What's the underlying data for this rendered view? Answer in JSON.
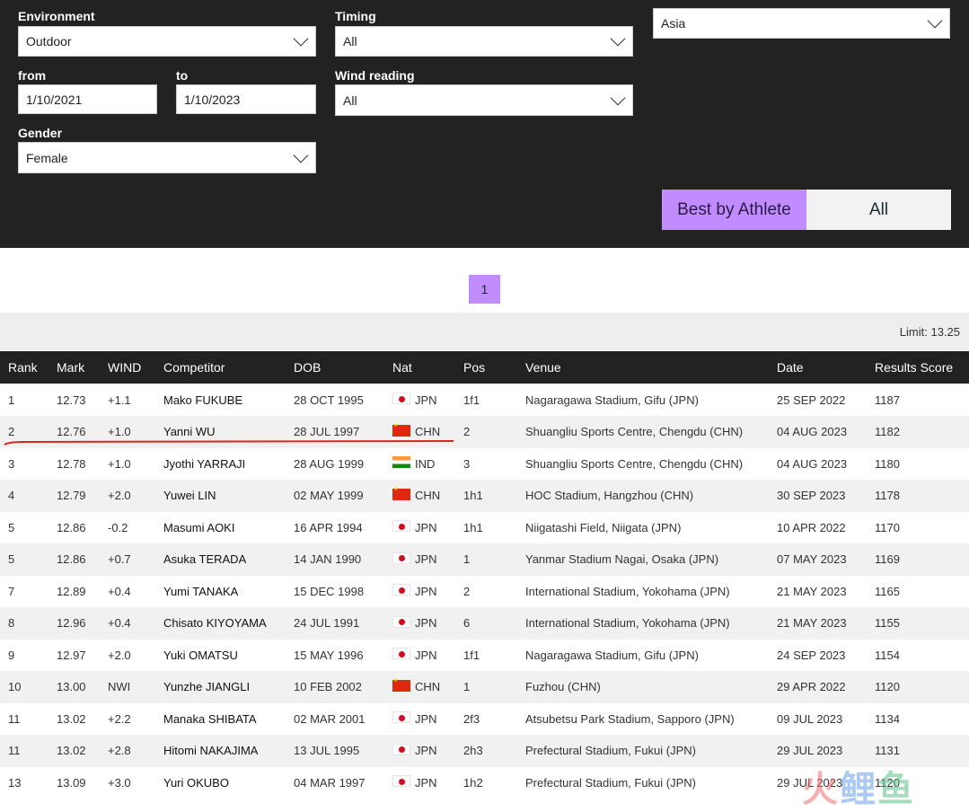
{
  "filters": {
    "environment": {
      "label": "Environment",
      "value": "Outdoor"
    },
    "from": {
      "label": "from",
      "value": "1/10/2021"
    },
    "to": {
      "label": "to",
      "value": "1/10/2023"
    },
    "gender": {
      "label": "Gender",
      "value": "Female"
    },
    "timing": {
      "label": "Timing",
      "value": "All"
    },
    "wind": {
      "label": "Wind reading",
      "value": "All"
    },
    "region": {
      "value": "Asia"
    }
  },
  "toggle": {
    "best": "Best by Athlete",
    "all": "All",
    "active": "best",
    "accent": "#c08cff"
  },
  "pagination": {
    "current": "1"
  },
  "limit": "Limit: 13.25",
  "table": {
    "headers": [
      "Rank",
      "Mark",
      "WIND",
      "Competitor",
      "DOB",
      "Nat",
      "Pos",
      "Venue",
      "Date",
      "Results Score"
    ],
    "rows": [
      {
        "rank": "1",
        "mark": "12.73",
        "wind": "+1.1",
        "name": "Mako FUKUBE",
        "dob": "28 OCT 1995",
        "flag": "jpn",
        "nat": "JPN",
        "pos": "1f1",
        "venue": "Nagaragawa Stadium, Gifu (JPN)",
        "date": "25 SEP 2022",
        "score": "1187"
      },
      {
        "rank": "2",
        "mark": "12.76",
        "wind": "+1.0",
        "name": "Yanni WU",
        "dob": "28 JUL 1997",
        "flag": "chn",
        "nat": "CHN",
        "pos": "2",
        "venue": "Shuangliu Sports Centre, Chengdu (CHN)",
        "date": "04 AUG 2023",
        "score": "1182"
      },
      {
        "rank": "3",
        "mark": "12.78",
        "wind": "+1.0",
        "name": "Jyothi YARRAJI",
        "dob": "28 AUG 1999",
        "flag": "ind",
        "nat": "IND",
        "pos": "3",
        "venue": "Shuangliu Sports Centre, Chengdu (CHN)",
        "date": "04 AUG 2023",
        "score": "1180"
      },
      {
        "rank": "4",
        "mark": "12.79",
        "wind": "+2.0",
        "name": "Yuwei LIN",
        "dob": "02 MAY 1999",
        "flag": "chn",
        "nat": "CHN",
        "pos": "1h1",
        "venue": "HOC Stadium, Hangzhou (CHN)",
        "date": "30 SEP 2023",
        "score": "1178"
      },
      {
        "rank": "5",
        "mark": "12.86",
        "wind": "-0.2",
        "name": "Masumi AOKI",
        "dob": "16 APR 1994",
        "flag": "jpn",
        "nat": "JPN",
        "pos": "1h1",
        "venue": "Niigatashi Field, Niigata (JPN)",
        "date": "10 APR 2022",
        "score": "1170"
      },
      {
        "rank": "5",
        "mark": "12.86",
        "wind": "+0.7",
        "name": "Asuka TERADA",
        "dob": "14 JAN 1990",
        "flag": "jpn",
        "nat": "JPN",
        "pos": "1",
        "venue": "Yanmar Stadium Nagai, Osaka (JPN)",
        "date": "07 MAY 2023",
        "score": "1169"
      },
      {
        "rank": "7",
        "mark": "12.89",
        "wind": "+0.4",
        "name": "Yumi TANAKA",
        "dob": "15 DEC 1998",
        "flag": "jpn",
        "nat": "JPN",
        "pos": "2",
        "venue": "International Stadium, Yokohama (JPN)",
        "date": "21 MAY 2023",
        "score": "1165"
      },
      {
        "rank": "8",
        "mark": "12.96",
        "wind": "+0.4",
        "name": "Chisato KIYOYAMA",
        "dob": "24 JUL 1991",
        "flag": "jpn",
        "nat": "JPN",
        "pos": "6",
        "venue": "International Stadium, Yokohama (JPN)",
        "date": "21 MAY 2023",
        "score": "1155"
      },
      {
        "rank": "9",
        "mark": "12.97",
        "wind": "+2.0",
        "name": "Yuki OMATSU",
        "dob": "15 MAY 1996",
        "flag": "jpn",
        "nat": "JPN",
        "pos": "1f1",
        "venue": "Nagaragawa Stadium, Gifu (JPN)",
        "date": "24 SEP 2023",
        "score": "1154"
      },
      {
        "rank": "10",
        "mark": "13.00",
        "wind": "NWI",
        "name": "Yunzhe JIANGLI",
        "dob": "10 FEB 2002",
        "flag": "chn",
        "nat": "CHN",
        "pos": "1",
        "venue": "Fuzhou (CHN)",
        "date": "29 APR 2022",
        "score": "1120"
      },
      {
        "rank": "11",
        "mark": "13.02",
        "wind": "+2.2",
        "name": "Manaka SHIBATA",
        "dob": "02 MAR 2001",
        "flag": "jpn",
        "nat": "JPN",
        "pos": "2f3",
        "venue": "Atsubetsu Park Stadium, Sapporo (JPN)",
        "date": "09 JUL 2023",
        "score": "1134"
      },
      {
        "rank": "11",
        "mark": "13.02",
        "wind": "+2.8",
        "name": "Hitomi NAKAJIMA",
        "dob": "13 JUL 1995",
        "flag": "jpn",
        "nat": "JPN",
        "pos": "2h3",
        "venue": "Prefectural Stadium, Fukui (JPN)",
        "date": "29 JUL 2023",
        "score": "1131"
      },
      {
        "rank": "13",
        "mark": "13.09",
        "wind": "+3.0",
        "name": "Yuri OKUBO",
        "dob": "04 MAR 1997",
        "flag": "jpn",
        "nat": "JPN",
        "pos": "1h2",
        "venue": "Prefectural Stadium, Fukui (JPN)",
        "date": "29 JUL 2023",
        "score": "1120"
      }
    ]
  },
  "annotation": {
    "color": "#d42a1e"
  },
  "watermark": "火鲤鱼"
}
